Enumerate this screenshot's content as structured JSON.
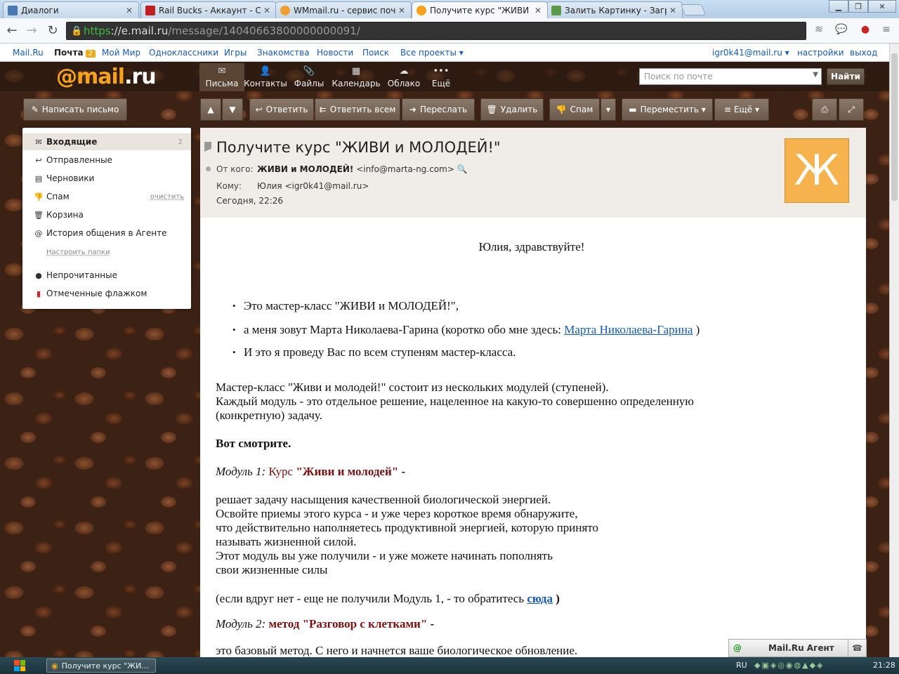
{
  "browser": {
    "tabs": [
      {
        "label": "Диалоги",
        "color": "#4a78b5"
      },
      {
        "label": "Rail Bucks - Аккаунт - Ск",
        "color": "#c02020"
      },
      {
        "label": "WMmail.ru - сервис почто",
        "color": "#f0a030"
      },
      {
        "label": "Получите курс \"ЖИВИ и",
        "color": "#f7a21b"
      },
      {
        "label": "Залить Картинку - Загру",
        "color": "#5a9a4a"
      }
    ],
    "active_tab": 3,
    "url_scheme": "https",
    "url_host": "://e.mail.ru",
    "url_path": "/message/14040663800000000091/"
  },
  "portal": {
    "links": [
      "Mail.Ru",
      "Почта",
      "Мой Мир",
      "Одноклассники",
      "Игры",
      "Знакомства",
      "Новости",
      "Поиск",
      "Все проекты ▾"
    ],
    "mail_count": "2",
    "user": "igr0k41@mail.ru ▾",
    "settings": "настройки",
    "logout": "выход"
  },
  "header": {
    "logo_at": "@",
    "logo_text": "mail",
    "logo_ru": ".ru",
    "services": [
      {
        "label": "Письма",
        "icon": "✉"
      },
      {
        "label": "Контакты",
        "icon": "👤"
      },
      {
        "label": "Файлы",
        "icon": "📎"
      },
      {
        "label": "Календарь",
        "icon": "▦"
      },
      {
        "label": "Облако",
        "icon": "☁"
      },
      {
        "label": "Ещё",
        "icon": "•••"
      }
    ],
    "search_placeholder": "Поиск по почте",
    "search_button": "Найти"
  },
  "toolbar": {
    "compose": "Написать письмо",
    "reply": "Ответить",
    "reply_all": "Ответить всем",
    "forward": "Переслать",
    "delete": "Удалить",
    "spam": "Спам",
    "move": "Переместить ▾",
    "more": "≡ Ещё ▾"
  },
  "folders": {
    "items": [
      {
        "label": "Входящие",
        "count": "2",
        "icon": "✉"
      },
      {
        "label": "Отправленные",
        "icon": "↩"
      },
      {
        "label": "Черновики",
        "icon": "▤"
      },
      {
        "label": "Спам",
        "icon": "👎",
        "action": "очистить"
      },
      {
        "label": "Корзина",
        "icon": "🗑"
      },
      {
        "label": "История общения в Агенте",
        "icon": "@"
      }
    ],
    "setup": "Настроить папки",
    "filters": [
      {
        "label": "Непрочитанные"
      },
      {
        "label": "Отмеченные флажком"
      }
    ]
  },
  "message": {
    "subject": "Получите курс \"ЖИВИ и МОЛОДЕЙ!\"",
    "from_label": "От кого:",
    "from_name": "ЖИВИ и МОЛОДЕЙ!",
    "from_email": "<info@marta-ng.com>",
    "to_label": "Кому:",
    "to": "Юлия <igr0k41@mail.ru>",
    "date": "Сегодня, 22:26",
    "avatar_letter": "Ж",
    "greeting": "Юлия, здравствуйте!",
    "bullet1": "Это мастер-класс \"ЖИВИ и МОЛОДЕЙ!\",",
    "bullet2_pre": "а меня зовут Марта Николаева-Гарина (коротко обо мне здесь: ",
    "bullet2_link": "Марта Николаева-Гарина",
    "bullet2_post": " )",
    "bullet3": "И это я проведу Вас по всем ступеням мастер-класса.",
    "p1_l1": "Мастер-класс \"Живи и молодей!\" состоит из нескольких модулей (ступеней).",
    "p1_l2": "Каждый модуль - это отдельное решение, нацеленное на какую-то совершенно определенную",
    "p1_l3": "(конкретную) задачу.",
    "look": "Вот смотрите.",
    "m1_label": "Модуль 1:",
    "m1_course": " Курс ",
    "m1_name": " \"Живи и молодей\" ",
    "m1_dash": " -",
    "m1_l1": "решает задачу насыщения качественной биологической энергией.",
    "m1_l2": "Освойте приемы этого курса - и уже через короткое время обнаружите,",
    "m1_l3": "что действительно  наполняетесь продуктивной энергией, которую принято",
    "m1_l4": "называть жизненной силой.",
    "m1_l5": "Этот модуль вы уже получили - и уже можете начинать пополнять",
    "m1_l6": "свои жизненные силы",
    "m1_note_pre": "(если вдруг нет - еще не получили Модуль 1,  - то обратитесь ",
    "m1_note_link": "сюда",
    "m1_note_post": " )",
    "m2_label": "Модуль 2:",
    "m2_name": " метод \"Разговор с клетками\"",
    "m2_dash": " -",
    "m2_l1": "это базовый метод. С него и начнется ваше биологическое обновление."
  },
  "agent": {
    "label": "Mail.Ru Агент"
  },
  "taskbar": {
    "item": "Получите курс \"ЖИ...",
    "lang": "RU",
    "time": "21:28"
  }
}
